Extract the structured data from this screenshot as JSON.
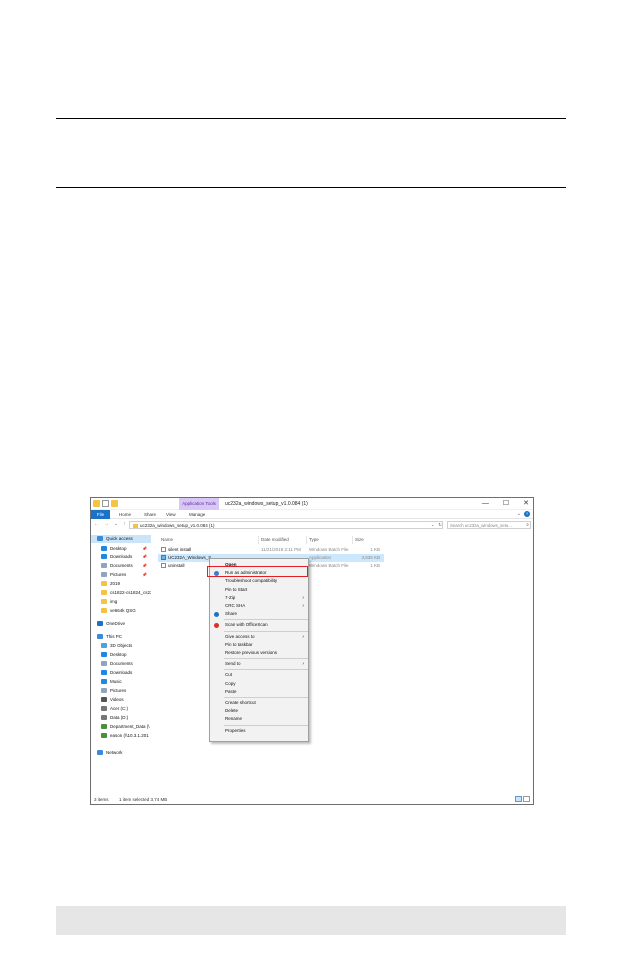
{
  "window": {
    "title": "uc232a_windows_setup_v1.0.084 (1)",
    "context_tab": "Application Tools",
    "controls": {
      "minimize": "—",
      "maximize": "☐",
      "close": "✕"
    }
  },
  "ribbon": {
    "tabs": [
      "File",
      "Home",
      "Share",
      "View",
      "Manage"
    ],
    "expand": "⌄"
  },
  "address": {
    "nav": [
      "←",
      "→",
      "⌄",
      "↑"
    ],
    "path": "uc232a_windows_setup_v1.0.084 (1)",
    "dropdown": "⌄",
    "refresh": "↻",
    "search_placeholder": "Search uc232a_windows_setu...",
    "search_icon": "⌕"
  },
  "nav_pane": [
    {
      "label": "Quick access",
      "icon": "star",
      "color": "#3c8bd9",
      "selected": true
    },
    {
      "label": "Desktop",
      "icon": "desktop",
      "color": "#1e88e5",
      "pin": "📌"
    },
    {
      "label": "Downloads",
      "icon": "download",
      "color": "#1e88e5",
      "pin": "📌"
    },
    {
      "label": "Documents",
      "icon": "documents",
      "color": "#8fa4bf",
      "pin": "📌"
    },
    {
      "label": "Pictures",
      "icon": "pictures",
      "color": "#8fa4bf",
      "pin": "📌"
    },
    {
      "label": "2019",
      "icon": "folder",
      "color": "#f5c343"
    },
    {
      "label": "cs1822-cs1824_cs23",
      "icon": "folder",
      "color": "#f5c343"
    },
    {
      "label": "img",
      "icon": "folder",
      "color": "#f5c343"
    },
    {
      "label": "ve664k QSG",
      "icon": "folder",
      "color": "#f5c343"
    },
    {
      "label": "OneDrive",
      "icon": "cloud",
      "color": "#1a73c9"
    },
    {
      "label": "This PC",
      "icon": "pc",
      "color": "#3c8bd9"
    },
    {
      "label": "3D Objects",
      "icon": "objects",
      "color": "#4aa3df"
    },
    {
      "label": "Desktop",
      "icon": "desktop",
      "color": "#1e88e5"
    },
    {
      "label": "Documents",
      "icon": "documents",
      "color": "#8fa4bf"
    },
    {
      "label": "Downloads",
      "icon": "download",
      "color": "#1e88e5"
    },
    {
      "label": "Music",
      "icon": "music",
      "color": "#1e88e5"
    },
    {
      "label": "Pictures",
      "icon": "pictures",
      "color": "#8fa4bf"
    },
    {
      "label": "Videos",
      "icon": "videos",
      "color": "#555555"
    },
    {
      "label": "Acer (C:)",
      "icon": "drive",
      "color": "#777777"
    },
    {
      "label": "Data (D:)",
      "icon": "drive",
      "color": "#777777"
    },
    {
      "label": "Department_Data (\\",
      "icon": "netdrive",
      "color": "#4a8f3c"
    },
    {
      "label": "eason (\\\\10.3.1.201",
      "icon": "netdrive",
      "color": "#4a8f3c"
    },
    {
      "label": "Network",
      "icon": "network",
      "color": "#3c8bd9"
    }
  ],
  "columns": [
    "Name",
    "Date modified",
    "Type",
    "Size"
  ],
  "files": [
    {
      "name": "silent install",
      "date": "11/21/2019 2:11 PM",
      "type": "Windows Batch File",
      "size": "1 KB",
      "kind": "batch"
    },
    {
      "name": "UC232A_Windows_S",
      "date": "",
      "type": "Application",
      "size": "3,836 KB",
      "kind": "app",
      "selected": true
    },
    {
      "name": "uninstall",
      "date": "",
      "type": "Windows Batch File",
      "size": "1 KB",
      "kind": "batch"
    }
  ],
  "context_menu": {
    "items": [
      {
        "label": "Open",
        "bold": true
      },
      {
        "label": "Run as administrator",
        "icon": "shield",
        "icon_color": "#3a7bd5",
        "highlighted": true
      },
      {
        "label": "Troubleshoot compatibility"
      },
      {
        "label": "Pin to Start"
      },
      {
        "label": "7-Zip",
        "submenu": true
      },
      {
        "label": "CRC SHA",
        "submenu": true
      },
      {
        "label": "Share",
        "icon": "share",
        "icon_color": "#1a73c9"
      },
      {
        "sep": true
      },
      {
        "label": "Scan with OfficeScan",
        "icon": "scan",
        "icon_color": "#d9302a"
      },
      {
        "sep": true
      },
      {
        "label": "Give access to",
        "submenu": true
      },
      {
        "label": "Pin to taskbar"
      },
      {
        "label": "Restore previous versions"
      },
      {
        "sep": true
      },
      {
        "label": "Send to",
        "submenu": true
      },
      {
        "sep": true
      },
      {
        "label": "Cut"
      },
      {
        "label": "Copy"
      },
      {
        "label": "Paste"
      },
      {
        "sep": true
      },
      {
        "label": "Create shortcut"
      },
      {
        "label": "Delete"
      },
      {
        "label": "Rename"
      },
      {
        "sep": true
      },
      {
        "label": "Properties"
      }
    ],
    "submenu_arrow": "›",
    "highlight_color": "#e01f28"
  },
  "status": {
    "items": "3 items",
    "selected": "1 item selected  3.74 MB"
  }
}
